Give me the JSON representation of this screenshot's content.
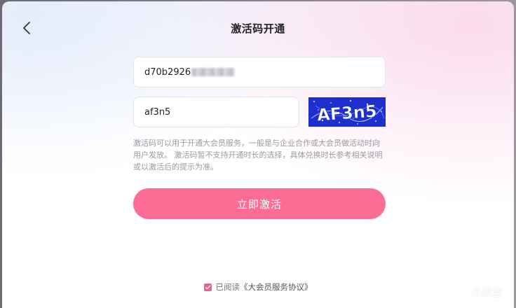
{
  "dialog": {
    "title": "激活码开通",
    "code_input": {
      "value": "d70b2926"
    },
    "captcha_input": {
      "value": "af3n5"
    },
    "captcha_image": {
      "text": "AF3n5"
    },
    "hint_text": "激活码可以用于开通大会员服务，一般是与企业合作或大会员做活动时向用户发放。 激活码暂不支持开通时长的选择，具体兑换时长参考相关说明或以激活后的提示为准。",
    "activate_button": "立即激活",
    "agreement": {
      "checked": true,
      "prefix": "已阅读",
      "link_label": "《大会员服务协议》"
    }
  },
  "watermark": {
    "text": "小黑盒"
  },
  "colors": {
    "accent_pink": "#fd6c94",
    "checkbox_pink": "#f25f8e",
    "captcha_blue": "#1e2fd0"
  },
  "icons": {
    "back": "chevron-left-icon",
    "check": "checkmark-icon",
    "watermark_logo": "xiaoheihe-logo-icon"
  }
}
